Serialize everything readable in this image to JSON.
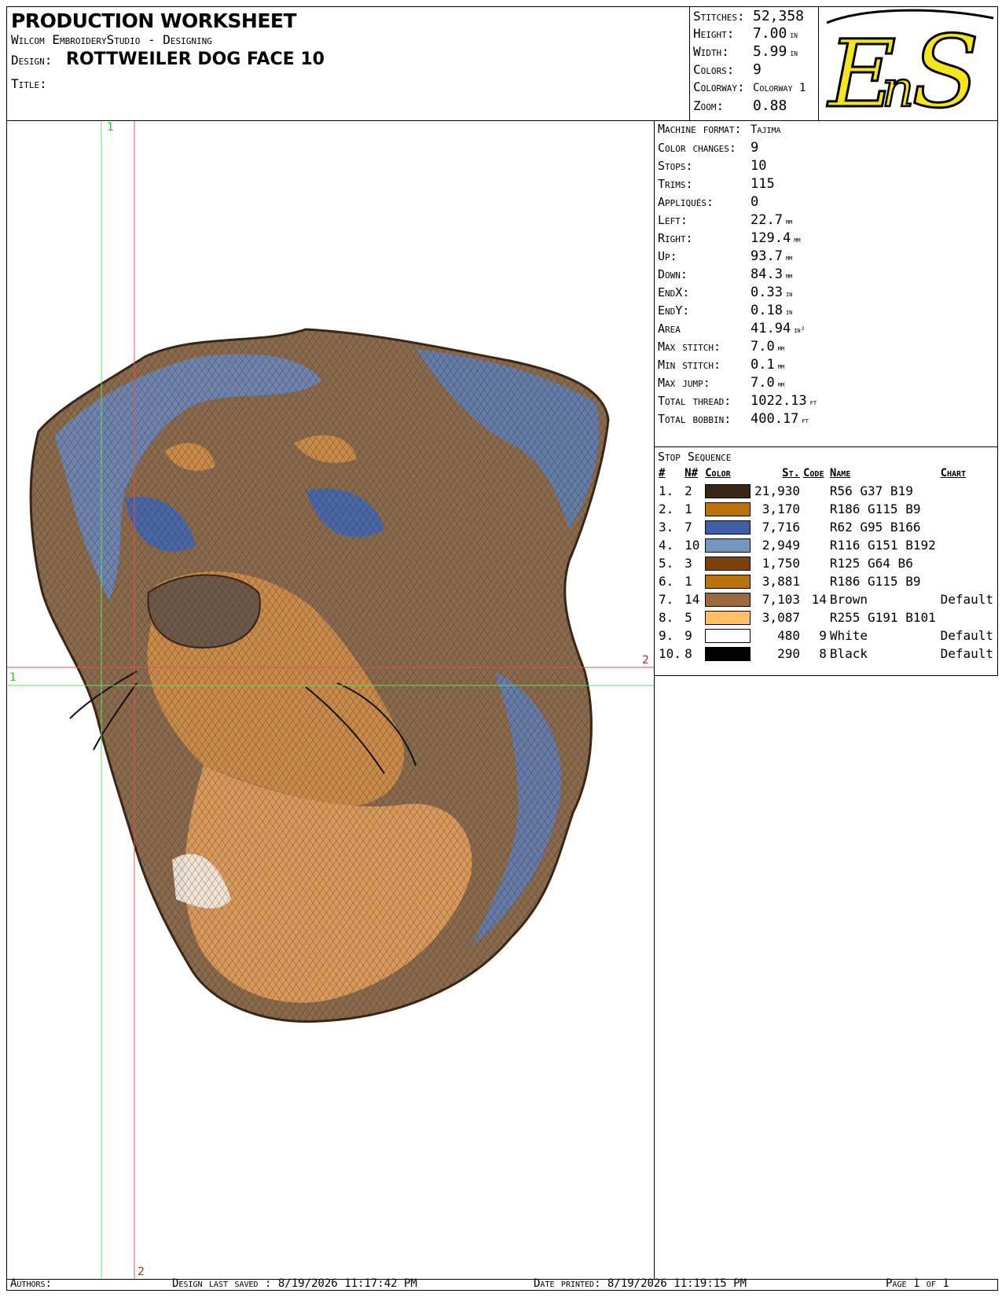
{
  "header": {
    "title": "PRODUCTION WORKSHEET",
    "software": "Wilcom EmbroideryStudio - Designing",
    "design_label": "Design:",
    "design_value": "ROTTWEILER DOG FACE 10",
    "title_label": "Title:"
  },
  "stats": [
    {
      "label": "Stitches:",
      "value": "52,358",
      "unit": ""
    },
    {
      "label": "Height:",
      "value": "7.00",
      "unit": "in"
    },
    {
      "label": "Width:",
      "value": "5.99",
      "unit": "in"
    },
    {
      "label": "Colors:",
      "value": "9",
      "unit": ""
    },
    {
      "label": "Colorway:",
      "value": "Colorway 1",
      "unit": ""
    },
    {
      "label": "Zoom:",
      "value": "0.88",
      "unit": ""
    }
  ],
  "logo": {
    "text": "EnS",
    "fill": "#f5e61c"
  },
  "properties": [
    {
      "label": "Machine format:",
      "value": "Tajima",
      "unit": ""
    },
    {
      "label": "Color changes:",
      "value": "9",
      "unit": ""
    },
    {
      "label": "Stops:",
      "value": "10",
      "unit": ""
    },
    {
      "label": "Trims:",
      "value": "115",
      "unit": ""
    },
    {
      "label": "Appliqués:",
      "value": "0",
      "unit": ""
    },
    {
      "label": "Left:",
      "value": "22.7",
      "unit": "mm"
    },
    {
      "label": "Right:",
      "value": "129.4",
      "unit": "mm"
    },
    {
      "label": "Up:",
      "value": "93.7",
      "unit": "mm"
    },
    {
      "label": "Down:",
      "value": "84.3",
      "unit": "mm"
    },
    {
      "label": "EndX:",
      "value": "0.33",
      "unit": "in"
    },
    {
      "label": "EndY:",
      "value": "0.18",
      "unit": "in"
    },
    {
      "label": "Area",
      "value": "41.94",
      "unit": "in²"
    },
    {
      "label": "Max stitch:",
      "value": "7.0",
      "unit": "mm"
    },
    {
      "label": "Min stitch:",
      "value": "0.1",
      "unit": "mm"
    },
    {
      "label": "Max jump:",
      "value": "7.0",
      "unit": "mm"
    },
    {
      "label": "Total thread:",
      "value": "1022.13",
      "unit": "ft"
    },
    {
      "label": "Total bobbin:",
      "value": "400.17",
      "unit": "ft"
    }
  ],
  "stop_sequence": {
    "title": "Stop Sequence",
    "columns": [
      "#",
      "N#",
      "Color",
      "St.",
      "Code",
      "Name",
      "Chart"
    ],
    "rows": [
      {
        "n": "1.",
        "needle": "2",
        "color": "#3a2616",
        "stitches": "21,930",
        "code": "",
        "name": "R56 G37 B19",
        "chart": ""
      },
      {
        "n": "2.",
        "needle": "1",
        "color": "#ba7309",
        "stitches": "3,170",
        "code": "",
        "name": "R186 G115 B9",
        "chart": ""
      },
      {
        "n": "3.",
        "needle": "7",
        "color": "#3e5fa6",
        "stitches": "7,716",
        "code": "",
        "name": "R62 G95 B166",
        "chart": ""
      },
      {
        "n": "4.",
        "needle": "10",
        "color": "#7497c0",
        "stitches": "2,949",
        "code": "",
        "name": "R116 G151 B192",
        "chart": ""
      },
      {
        "n": "5.",
        "needle": "3",
        "color": "#7d4006",
        "stitches": "1,750",
        "code": "",
        "name": "R125 G64 B6",
        "chart": ""
      },
      {
        "n": "6.",
        "needle": "1",
        "color": "#ba7309",
        "stitches": "3,881",
        "code": "",
        "name": "R186 G115 B9",
        "chart": ""
      },
      {
        "n": "7.",
        "needle": "14",
        "color": "#9a6a3c",
        "stitches": "7,103",
        "code": "14",
        "name": "Brown",
        "chart": "Default"
      },
      {
        "n": "8.",
        "needle": "5",
        "color": "#ffbf65",
        "stitches": "3,087",
        "code": "",
        "name": "R255 G191 B101",
        "chart": ""
      },
      {
        "n": "9.",
        "needle": "9",
        "color": "#ffffff",
        "stitches": "480",
        "code": "9",
        "name": "White",
        "chart": "Default"
      },
      {
        "n": "10.",
        "needle": "8",
        "color": "#000000",
        "stitches": "290",
        "code": "8",
        "name": "Black",
        "chart": "Default"
      }
    ]
  },
  "guides": {
    "v1": "1",
    "h1": "1",
    "v2": "2",
    "h2": "2"
  },
  "footer": {
    "authors": "Authors:",
    "saved": "Design last saved : 8/19/2026 11:17:42 PM",
    "printed": "Date printed: 8/19/2026 11:19:15 PM",
    "page": "Page 1 of 1"
  }
}
